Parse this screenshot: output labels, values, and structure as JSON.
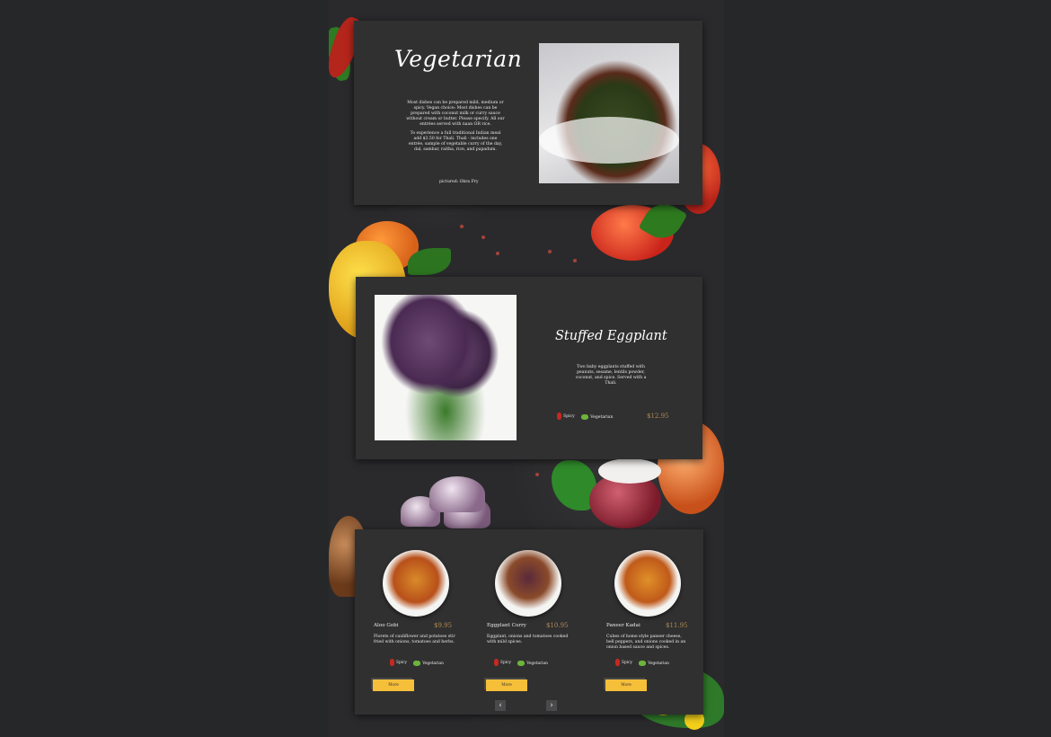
{
  "card1": {
    "title": "Vegetarian",
    "description1": "Most dishes can be prepared mild, medium or spicy. Vegan choice: Most dishes can be prepared with coconut milk or curry sauce without cream or butter. Please specify. All our entrées served with naan OR rice.",
    "description2": "To experience a full traditional Indian meal add $3.50 for Thali. Thali - includes one entrée, sample of vegetable curry of the day, dal, sambar, raitha, rice, and papadum.",
    "photo_caption": "pictured: Okra Fry"
  },
  "card2": {
    "title": "Stuffed Eggplant",
    "description": "Two baby eggplants stuffed with peanuts, sesame, lentils powder, coconut, and spice. Served with a Thali.",
    "tags": [
      "Spicy",
      "Vegetarian"
    ],
    "price": "$12.95"
  },
  "card3": {
    "items": [
      {
        "name": "Aloo Gobi",
        "price": "$9.95",
        "description": "Florets of cauliflower and potatoes stir fried with onions, tomatoes and herbs.",
        "tags": [
          "Spicy",
          "Vegetarian"
        ],
        "button_label": "More"
      },
      {
        "name": "Eggplant Curry",
        "price": "$10.95",
        "description": "Eggplant, onions and tomatoes cooked with mild spices.",
        "tags": [
          "Spicy",
          "Vegetarian"
        ],
        "button_label": "More"
      },
      {
        "name": "Paneer Kadai",
        "price": "$11.95",
        "description": "Cubes of home style paneer cheese, bell peppers, and onions cooked in an onion based sauce and spices.",
        "tags": [
          "Spicy",
          "Vegetarian"
        ],
        "button_label": "More"
      }
    ],
    "prev_icon": "chevron-left-icon",
    "next_icon": "chevron-right-icon"
  },
  "colors": {
    "page_bg": "#262729",
    "card_bg": "#303031",
    "price": "#b18a52",
    "button": "#f6bf3a"
  }
}
